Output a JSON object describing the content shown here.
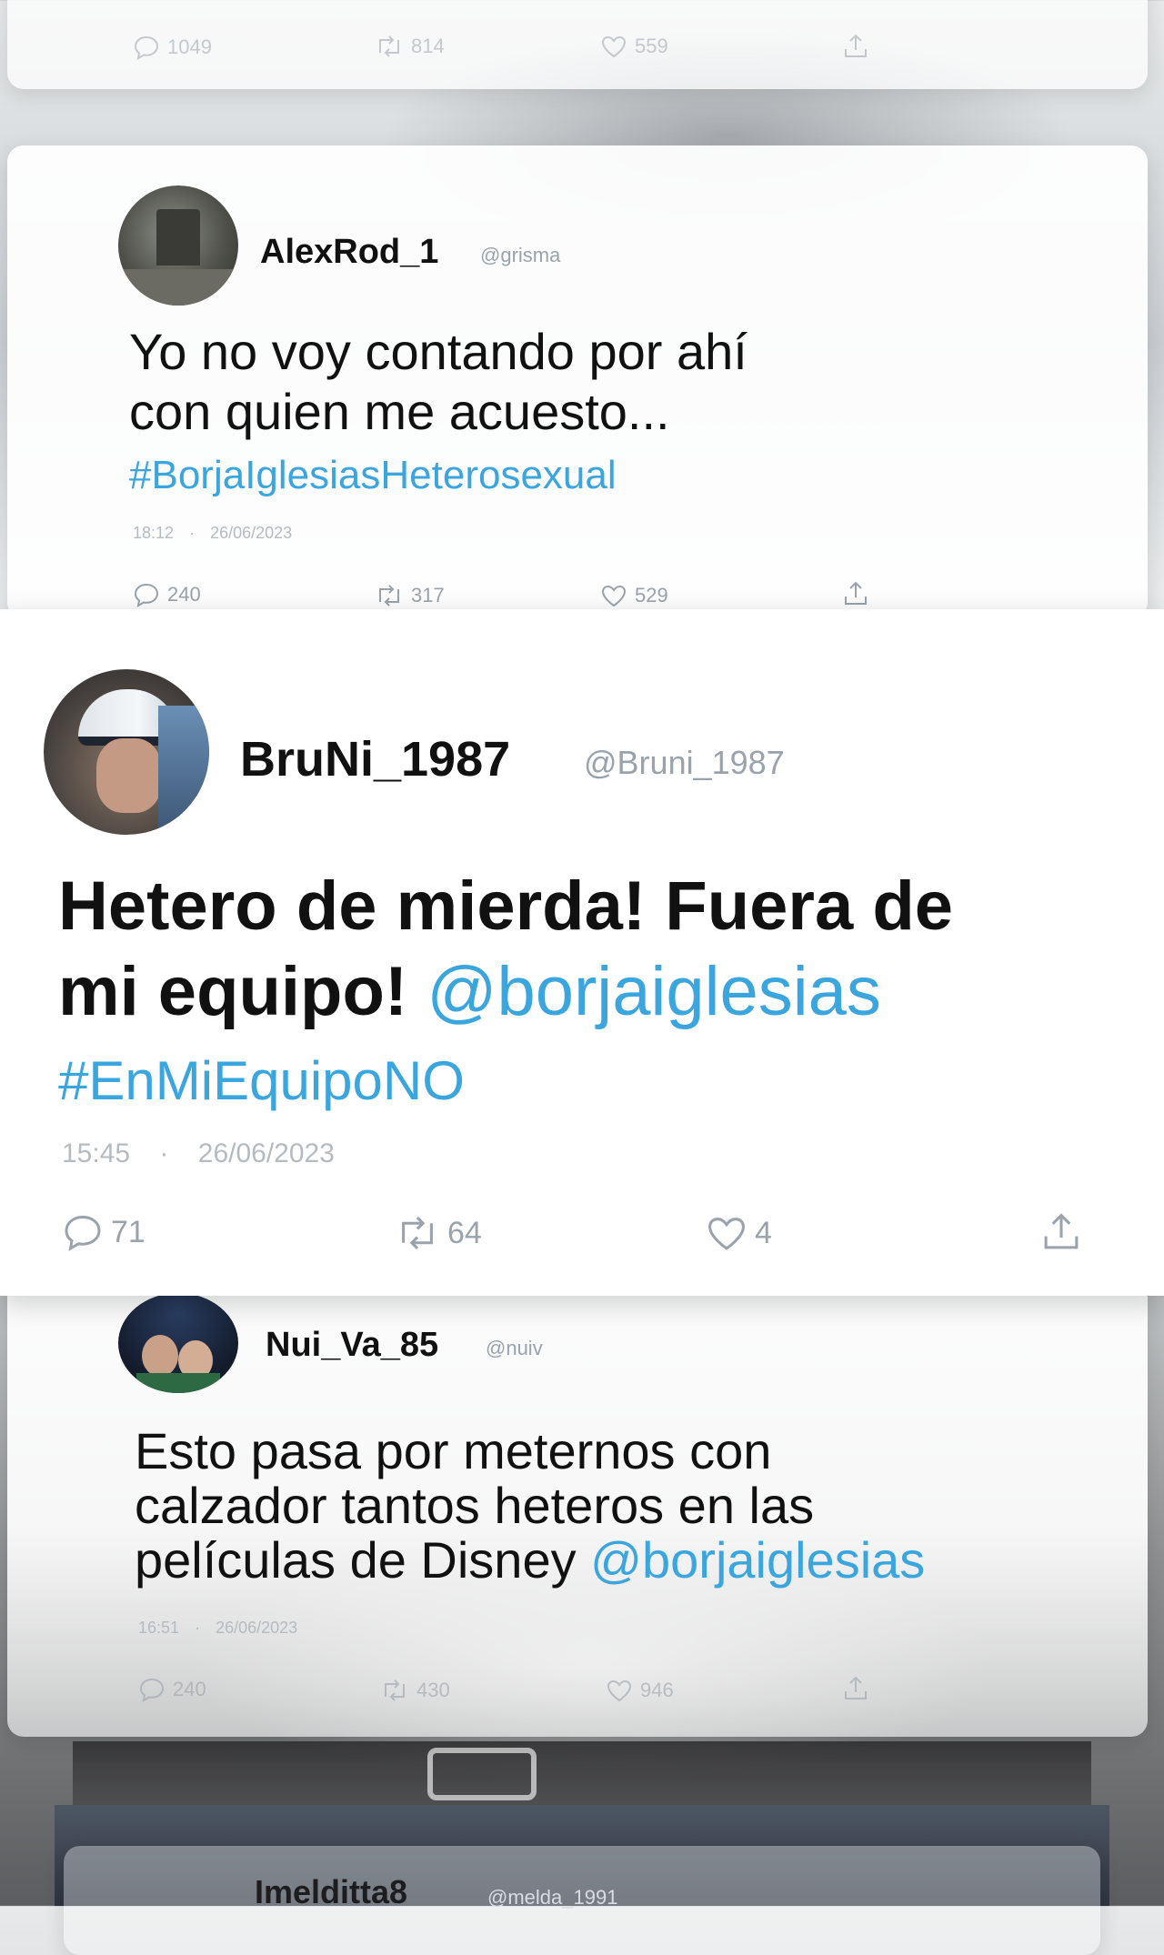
{
  "top_card": {
    "reply_count": "1049",
    "retweet_count": "814",
    "like_count": "559"
  },
  "tweets": [
    {
      "name": "AlexRod_1",
      "handle": "@grisma",
      "text_line1": "Yo no voy contando por ahí",
      "text_line2": "con quien me acuesto...",
      "hashtag": "#BorjaIglesiasHeterosexual",
      "time": "18:12",
      "date": "26/06/2023",
      "replies": "240",
      "retweets": "317",
      "likes": "529"
    },
    {
      "name": "BruNi_1987",
      "handle": "@Bruni_1987",
      "text_line1": "Hetero de mierda! Fuera de",
      "text_line2_plain": "mi equipo! ",
      "mention": "@borjaiglesias",
      "hashtag": "#EnMiEquipoNO",
      "time": "15:45",
      "date": "26/06/2023",
      "replies": "71",
      "retweets": "64",
      "likes": "4"
    },
    {
      "name": "Nui_Va_85",
      "handle": "@nuiv",
      "text_line1": "Esto pasa por meternos con",
      "text_line2": "calzador tantos heteros en las",
      "text_line3_plain": "películas de Disney ",
      "mention": "@borjaiglesias",
      "time": "16:51",
      "date": "26/06/2023",
      "replies": "240",
      "retweets": "430",
      "likes": "946"
    }
  ],
  "bottom_peek": {
    "name": "Imelditta8",
    "handle": "@melda_1991"
  },
  "separator": "·",
  "colors": {
    "link": "#3ba5dd",
    "text": "#111111",
    "muted": "#9aa3ab"
  },
  "icons": [
    "reply-icon",
    "retweet-icon",
    "like-icon",
    "share-icon"
  ]
}
